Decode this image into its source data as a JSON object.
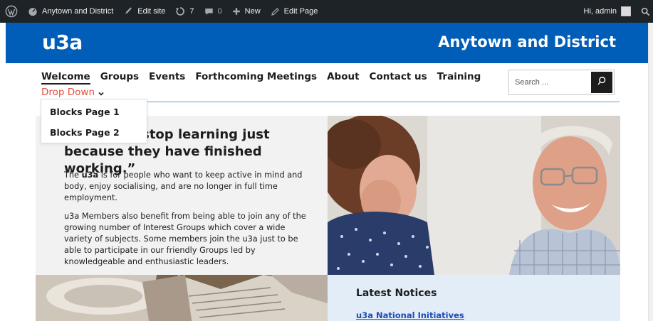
{
  "admin_bar": {
    "site_name": "Anytown and District",
    "edit_site": "Edit site",
    "updates_count": "7",
    "comments_count": "0",
    "new_label": "New",
    "edit_page": "Edit Page",
    "greeting": "Hi, admin"
  },
  "header": {
    "logo": "u3a",
    "site_title": "Anytown and District",
    "brand_color": "#005eb8"
  },
  "nav": {
    "items": [
      {
        "label": "Welcome"
      },
      {
        "label": "Groups"
      },
      {
        "label": "Events"
      },
      {
        "label": "Forthcoming Meetings"
      },
      {
        "label": "About"
      },
      {
        "label": "Contact us"
      },
      {
        "label": "Training"
      }
    ],
    "dropdown_label": "Drop Down",
    "dropdown_items": [
      {
        "label": "Blocks Page 1"
      },
      {
        "label": "Blocks Page 2"
      }
    ],
    "accent_color": "#e0513f"
  },
  "search": {
    "placeholder": "Search ..."
  },
  "hero": {
    "quote_visible": "ds to stop learning just because they have finished working.”",
    "p1_prefix": "The ",
    "p1_bold": "u3a",
    "p1_rest": " is for people who want to keep active in mind and body, enjoy socialising, and are no longer in full time employment.",
    "p2": "u3a Members also benefit from being able to join any of the growing number of Interest Groups which cover a wide variety of subjects. Some members join the u3a just to be able to participate in our friendly Groups led by knowledgeable and enthusiastic leaders."
  },
  "notices": {
    "title": "Latest Notices",
    "link": "u3a National Initiatives"
  }
}
